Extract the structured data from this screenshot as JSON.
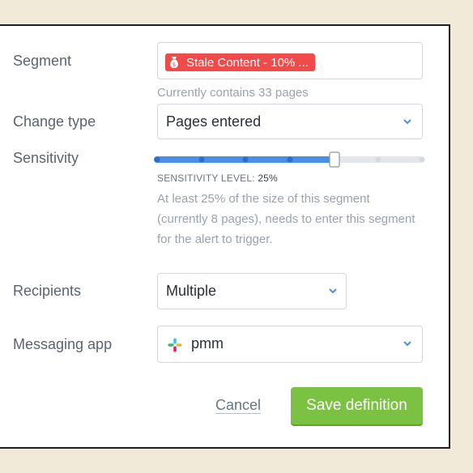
{
  "form": {
    "segment": {
      "label": "Segment",
      "tag_text": "Stale Content - 10% ...",
      "tag_icon": "money-bag-icon",
      "helper": "Currently contains 33 pages"
    },
    "change_type": {
      "label": "Change type",
      "value": "Pages entered"
    },
    "sensitivity": {
      "label": "Sensitivity",
      "level_label": "SENSITIVITY LEVEL:",
      "level_value": "25%",
      "level_fraction": 0.25,
      "description_line1": "At least 25% of the size of this segment",
      "description_line2": "(currently 8 pages), needs to enter this segment",
      "description_line3": "for the alert to trigger."
    },
    "recipients": {
      "label": "Recipients",
      "value": "Multiple"
    },
    "messaging_app": {
      "label": "Messaging app",
      "value": "pmm",
      "icon": "slack-icon"
    }
  },
  "actions": {
    "cancel_label": "Cancel",
    "save_label": "Save definition"
  },
  "colors": {
    "accent_blue": "#4a8ee6",
    "tag_red": "#ef4b4b",
    "save_green": "#7cc242",
    "background": "#f2ead9"
  }
}
